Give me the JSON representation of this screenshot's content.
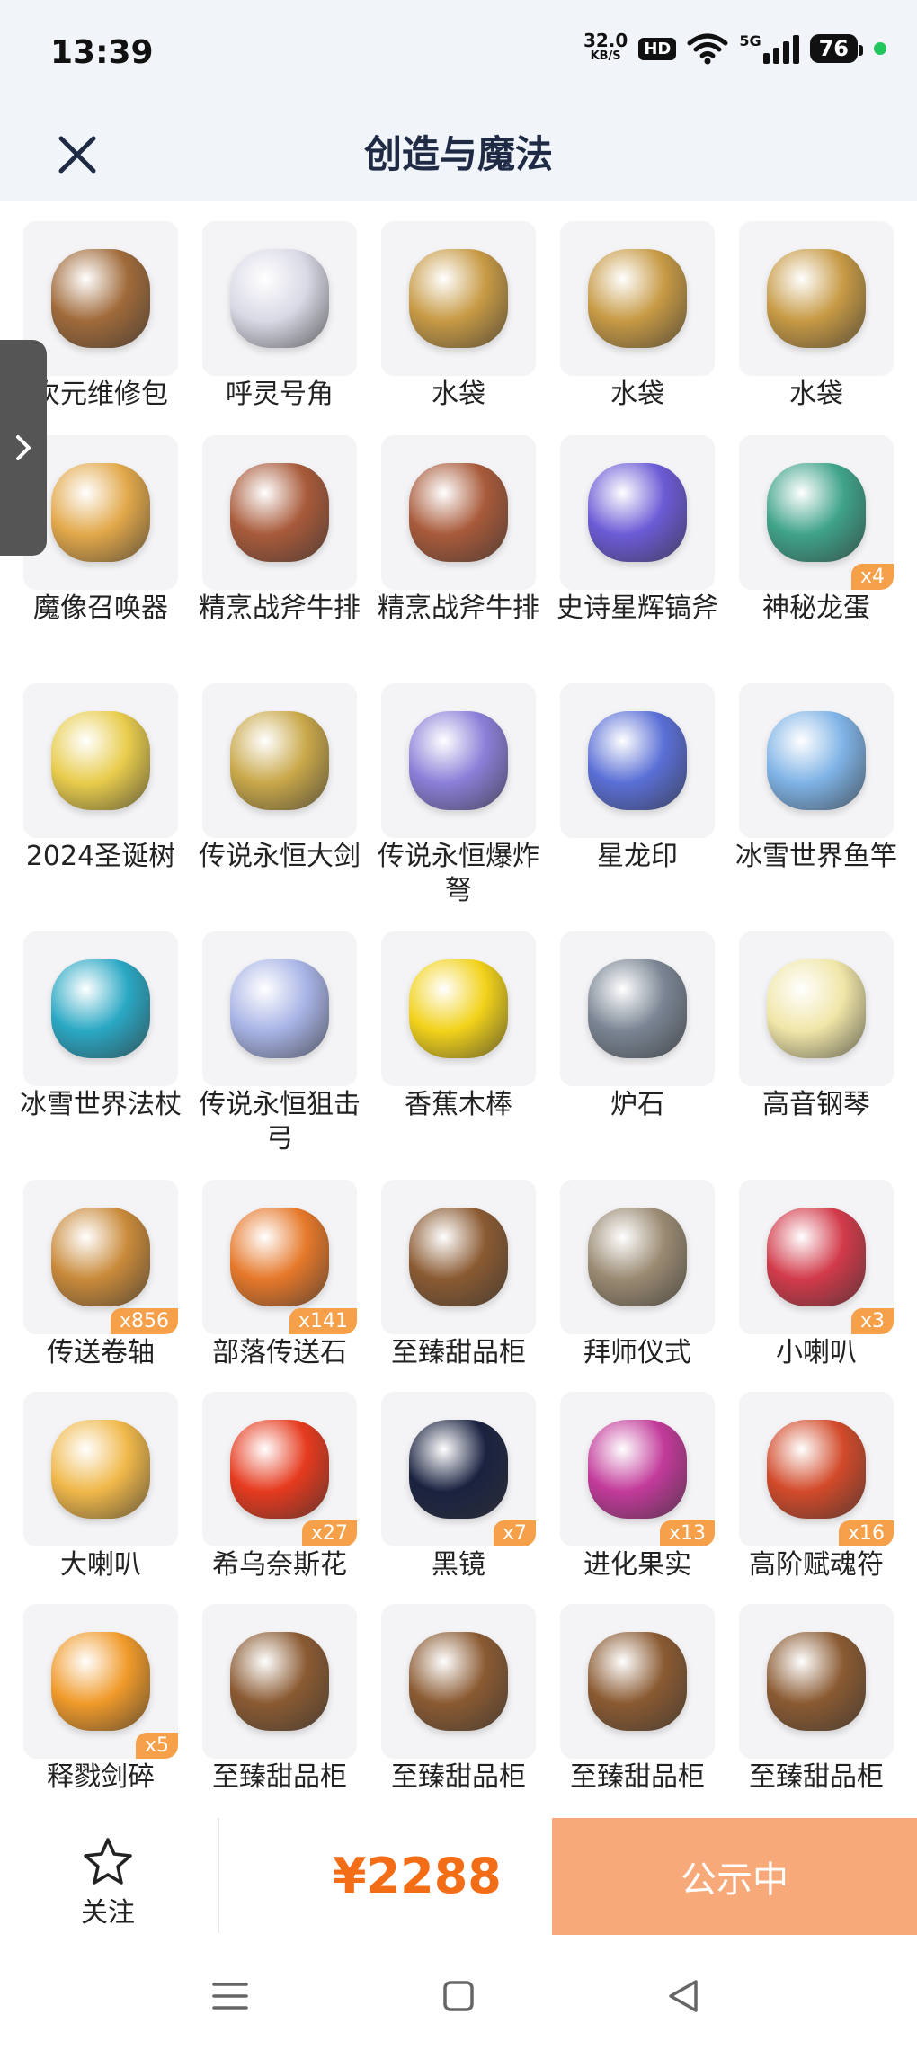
{
  "status_bar": {
    "time": "13:39",
    "speed_value": "32.0",
    "speed_unit": "KB/S",
    "hd": "HD",
    "network": "5G",
    "battery": "76",
    "battery_level_percent": 76
  },
  "header": {
    "title": "创造与魔法",
    "close_icon": "close-icon"
  },
  "items": [
    {
      "name": "次元维修包",
      "badge": "",
      "icon": "repair-bag-icon",
      "color": "#a06a3a"
    },
    {
      "name": "呼灵号角",
      "badge": "",
      "icon": "horn-icon",
      "color": "#d9d9e6"
    },
    {
      "name": "水袋",
      "badge": "",
      "icon": "water-bag-icon",
      "color": "#c79a45"
    },
    {
      "name": "水袋",
      "badge": "",
      "icon": "water-bag-icon",
      "color": "#c79a45"
    },
    {
      "name": "水袋",
      "badge": "",
      "icon": "water-bag-icon",
      "color": "#c79a45"
    },
    {
      "name": "魔像召唤器",
      "badge": "",
      "icon": "golem-summoner-icon",
      "color": "#e2a84a"
    },
    {
      "name": "精烹战斧牛排",
      "badge": "",
      "icon": "steak-icon",
      "color": "#a85a3a"
    },
    {
      "name": "精烹战斧牛排",
      "badge": "",
      "icon": "steak-icon",
      "color": "#a85a3a"
    },
    {
      "name": "史诗星辉镐斧",
      "badge": "",
      "icon": "axe-icon",
      "color": "#6b5bd6"
    },
    {
      "name": "神秘龙蛋",
      "badge": "x4",
      "icon": "dragon-egg-icon",
      "color": "#3fa38a"
    },
    {
      "name": "2024圣诞树",
      "badge": "",
      "icon": "christmas-tree-icon",
      "color": "#e8cc4c"
    },
    {
      "name": "传说永恒大剑",
      "badge": "",
      "icon": "sword-icon",
      "color": "#c9a84a"
    },
    {
      "name": "传说永恒爆炸弩",
      "badge": "",
      "icon": "crossbow-icon",
      "color": "#8a7fd8"
    },
    {
      "name": "星龙印",
      "badge": "",
      "icon": "dragon-seal-icon",
      "color": "#5a6fd6"
    },
    {
      "name": "冰雪世界鱼竿",
      "badge": "",
      "icon": "fishing-rod-icon",
      "color": "#7fb3e6"
    },
    {
      "name": "冰雪世界法杖",
      "badge": "",
      "icon": "staff-icon",
      "color": "#2aa8c4"
    },
    {
      "name": "传说永恒狙击弓",
      "badge": "",
      "icon": "bow-icon",
      "color": "#a8b4e6"
    },
    {
      "name": "香蕉木棒",
      "badge": "",
      "icon": "banana-icon",
      "color": "#f2d21a"
    },
    {
      "name": "炉石",
      "badge": "",
      "icon": "hearthstone-icon",
      "color": "#7a8593"
    },
    {
      "name": "高音钢琴",
      "badge": "",
      "icon": "piano-icon",
      "color": "#f0e6a8"
    },
    {
      "name": "传送卷轴",
      "badge": "x856",
      "icon": "scroll-icon",
      "color": "#c98a3a"
    },
    {
      "name": "部落传送石",
      "badge": "x141",
      "icon": "teleport-stone-icon",
      "color": "#e6782a"
    },
    {
      "name": "至臻甜品柜",
      "badge": "",
      "icon": "dessert-cabinet-icon",
      "color": "#8a5a32"
    },
    {
      "name": "拜师仪式",
      "badge": "",
      "icon": "ceremony-icon",
      "color": "#9a8a72"
    },
    {
      "name": "小喇叭",
      "badge": "x3",
      "icon": "megaphone-icon",
      "color": "#d23a4a"
    },
    {
      "name": "大喇叭",
      "badge": "",
      "icon": "big-megaphone-icon",
      "color": "#f0b84a"
    },
    {
      "name": "希乌奈斯花",
      "badge": "x27",
      "icon": "flower-icon",
      "color": "#e63a1e"
    },
    {
      "name": "黑镜",
      "badge": "x7",
      "icon": "black-mirror-icon",
      "color": "#1a2240"
    },
    {
      "name": "进化果实",
      "badge": "x13",
      "icon": "fruit-icon",
      "color": "#c23a9a"
    },
    {
      "name": "高阶赋魂符",
      "badge": "x16",
      "icon": "talisman-icon",
      "color": "#d24a2a"
    },
    {
      "name": "释戮剑碎",
      "badge": "x5",
      "icon": "sword-shard-icon",
      "color": "#f09a2a"
    },
    {
      "name": "至臻甜品柜",
      "badge": "",
      "icon": "dessert-cabinet-icon",
      "color": "#8a5a32"
    },
    {
      "name": "至臻甜品柜",
      "badge": "",
      "icon": "dessert-cabinet-icon",
      "color": "#8a5a32"
    },
    {
      "name": "至臻甜品柜",
      "badge": "",
      "icon": "dessert-cabinet-icon",
      "color": "#8a5a32"
    },
    {
      "name": "至臻甜品柜",
      "badge": "",
      "icon": "dessert-cabinet-icon",
      "color": "#8a5a32"
    }
  ],
  "bottom_bar": {
    "follow_label": "关注",
    "follow_icon": "star-icon",
    "price": "¥2288",
    "status_button": "公示中",
    "accent_color": "#f36c16",
    "button_color": "#f8a97a"
  },
  "nav_bar": {
    "menu_icon": "menu-icon",
    "home_icon": "home-icon",
    "back_icon": "back-icon"
  }
}
